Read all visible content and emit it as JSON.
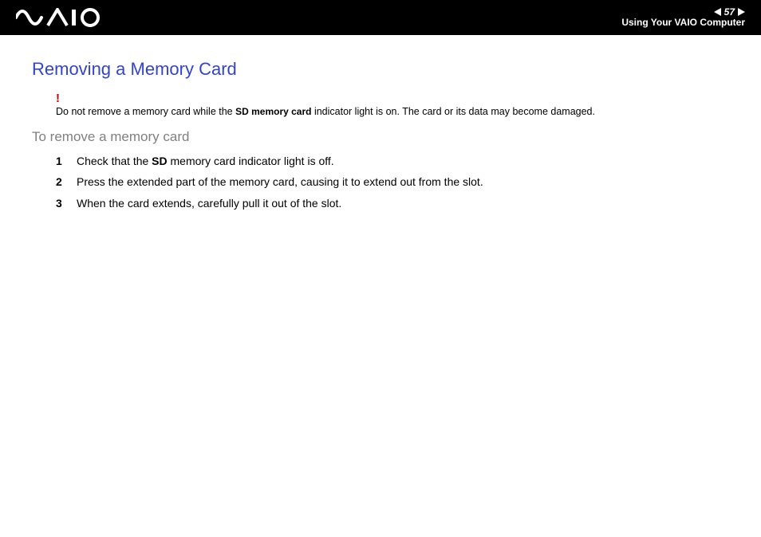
{
  "header": {
    "page_number": "57",
    "section": "Using Your VAIO Computer"
  },
  "title": "Removing a Memory Card",
  "warning": {
    "mark": "!",
    "pre": "Do not remove a memory card while the ",
    "bold": "SD",
    "mid": " memory card",
    "post": " indicator light is on. The card or its data may become damaged."
  },
  "subhead": "To remove a memory card",
  "steps": [
    {
      "n": "1",
      "pre": "Check that the ",
      "bold": "SD",
      "post": " memory card indicator light is off."
    },
    {
      "n": "2",
      "pre": "Press the extended part of the memory card, causing it to extend out from the slot.",
      "bold": "",
      "post": ""
    },
    {
      "n": "3",
      "pre": "When the card extends, carefully pull it out of the slot.",
      "bold": "",
      "post": ""
    }
  ]
}
